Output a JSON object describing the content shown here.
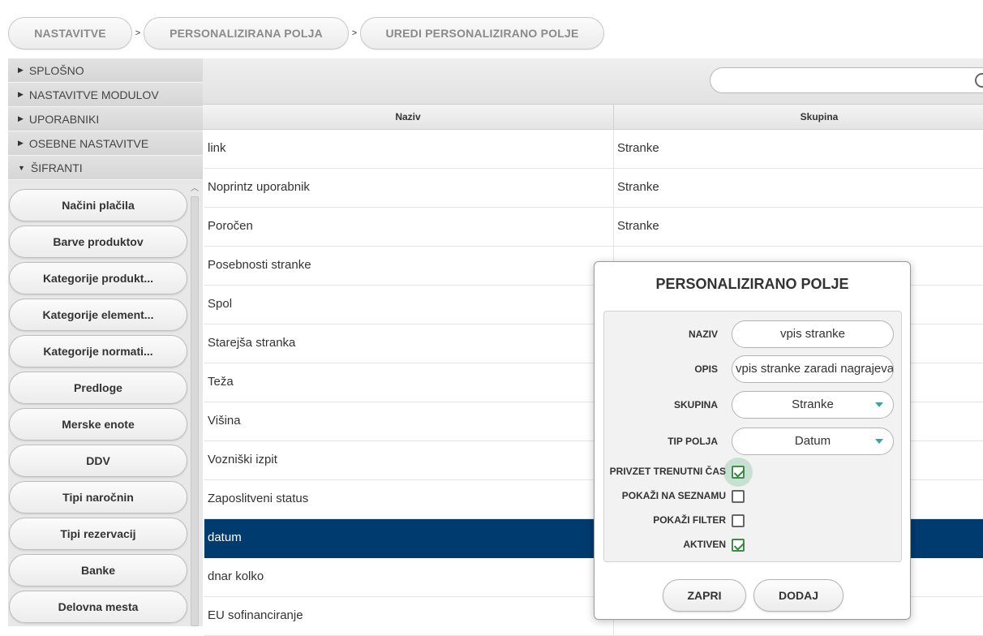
{
  "breadcrumb": {
    "items": [
      {
        "label": "NASTAVITVE"
      },
      {
        "label": "PERSONALIZIRANA POLJA"
      },
      {
        "label": "UREDI PERSONALIZIRANO POLJE"
      }
    ],
    "separator": ">"
  },
  "sidebar": {
    "sections": [
      {
        "label": "SPLOŠNO",
        "icon": "triangle-right"
      },
      {
        "label": "NASTAVITVE MODULOV",
        "icon": "triangle-right"
      },
      {
        "label": "UPORABNIKI",
        "icon": "triangle-right"
      },
      {
        "label": "OSEBNE NASTAVITVE",
        "icon": "triangle-right"
      },
      {
        "label": "ŠIFRANTI",
        "icon": "triangle-down"
      }
    ],
    "items": [
      {
        "label": "Načini plačila"
      },
      {
        "label": "Barve produktov"
      },
      {
        "label": "Kategorije produkt..."
      },
      {
        "label": "Kategorije element..."
      },
      {
        "label": "Kategorije normati..."
      },
      {
        "label": "Predloge"
      },
      {
        "label": "Merske enote"
      },
      {
        "label": "DDV"
      },
      {
        "label": "Tipi naročnin"
      },
      {
        "label": "Tipi rezervacij"
      },
      {
        "label": "Banke"
      },
      {
        "label": "Delovna mesta"
      }
    ]
  },
  "table": {
    "columns": [
      "Naziv",
      "Skupina"
    ],
    "rows": [
      {
        "naziv": "link",
        "skupina": "Stranke"
      },
      {
        "naziv": "Noprintz uporabnik",
        "skupina": "Stranke"
      },
      {
        "naziv": "Poročen",
        "skupina": "Stranke"
      },
      {
        "naziv": "Posebnosti stranke",
        "skupina": ""
      },
      {
        "naziv": "Spol",
        "skupina": ""
      },
      {
        "naziv": "Starejša stranka",
        "skupina": ""
      },
      {
        "naziv": "Teža",
        "skupina": ""
      },
      {
        "naziv": "Višina",
        "skupina": ""
      },
      {
        "naziv": "Vozniški izpit",
        "skupina": ""
      },
      {
        "naziv": "Zaposlitveni status",
        "skupina": ""
      },
      {
        "naziv": "datum",
        "skupina": ""
      },
      {
        "naziv": "dnar kolko",
        "skupina": ""
      },
      {
        "naziv": "EU sofinanciranje",
        "skupina": ""
      }
    ],
    "selected_row": "datum"
  },
  "search": {
    "placeholder": "",
    "value": "",
    "icon": "search-icon"
  },
  "dialog": {
    "title": "PERSONALIZIRANO POLJE",
    "fields": {
      "naziv": {
        "label": "NAZIV",
        "value": "vpis stranke"
      },
      "opis": {
        "label": "OPIS",
        "value": "vpis stranke zaradi nagrajevanja"
      },
      "skupina": {
        "label": "SKUPINA",
        "value": "Stranke"
      },
      "tip_polja": {
        "label": "TIP POLJA",
        "value": "Datum"
      }
    },
    "checkboxes": [
      {
        "label": "PRIVZET TRENUTNI ČAS",
        "checked": true
      },
      {
        "label": "POKAŽI NA SEZNAMU",
        "checked": false
      },
      {
        "label": "POKAŽI FILTER",
        "checked": false
      },
      {
        "label": "AKTIVEN",
        "checked": true
      }
    ],
    "buttons": {
      "close": "ZAPRI",
      "add": "DODAJ"
    }
  },
  "colors": {
    "selected_row": "#003b6f",
    "checkbox_check": "#2e8a3a",
    "select_arrow": "#3aa5a0"
  }
}
